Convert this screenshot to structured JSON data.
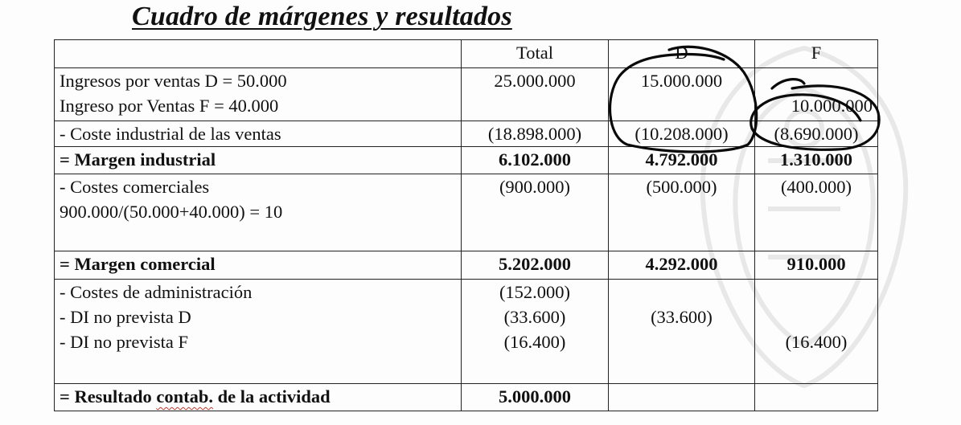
{
  "title": "Cuadro de márgenes y resultados",
  "table": {
    "headers": [
      "",
      "Total",
      "D",
      "F"
    ],
    "rows": {
      "ingresos": {
        "label_lines": [
          "Ingresos por ventas D = 50.000",
          "Ingreso por Ventas F = 40.000"
        ],
        "total": "25.000.000",
        "d": "15.000.000",
        "f": "10.000.000"
      },
      "coste_industrial": {
        "label": "- Coste industrial de las ventas",
        "total": "(18.898.000)",
        "d": "(10.208.000)",
        "f": "(8.690.000)"
      },
      "margen_industrial": {
        "label": "= Margen industrial",
        "total": "6.102.000",
        "d": "4.792.000",
        "f": "1.310.000"
      },
      "costes_comerciales": {
        "label_lines": [
          "- Costes comerciales",
          "900.000/(50.000+40.000) = 10"
        ],
        "total": "(900.000)",
        "d": "(500.000)",
        "f": "(400.000)"
      },
      "margen_comercial": {
        "label": "= Margen comercial",
        "total": "5.202.000",
        "d": "4.292.000",
        "f": "910.000"
      },
      "otros": {
        "label_lines": [
          "- Costes de administración",
          "- DI no prevista D",
          "- DI no prevista F"
        ],
        "total_lines": [
          "(152.000)",
          "(33.600)",
          "(16.400)"
        ],
        "d_lines": [
          "",
          "(33.600)",
          ""
        ],
        "f_lines": [
          "",
          "",
          "(16.400)"
        ]
      },
      "resultado": {
        "label_prefix": "= Resultado ",
        "label_marked": "contab.",
        "label_suffix": " de la actividad",
        "total": "5.000.000",
        "d": "",
        "f": ""
      }
    }
  },
  "colors": {
    "ink": "#111111",
    "grid": "#222222",
    "watermark": "#e6e6e6",
    "spellcheck": "#c0392b"
  }
}
